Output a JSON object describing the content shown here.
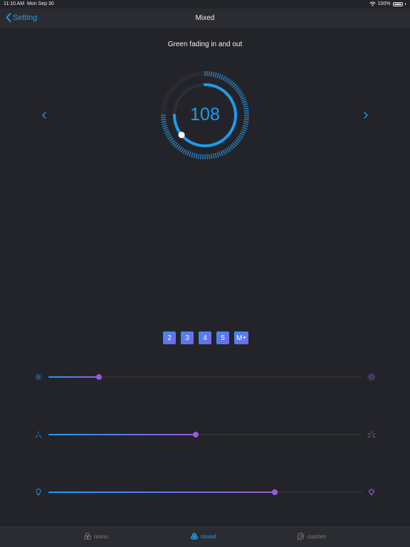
{
  "status": {
    "time": "11:10 AM",
    "date": "Mon Sep 30",
    "battery": "100%"
  },
  "nav": {
    "back_label": "Setting",
    "title": "Mixed"
  },
  "effect": {
    "name": "Green fading in and out",
    "value": "108",
    "dial_fraction": 0.75
  },
  "presets": [
    "2",
    "3",
    "4",
    "5",
    "M+"
  ],
  "sliders": [
    {
      "icon": "brightness-icon",
      "value": 0.16
    },
    {
      "icon": "sparkle-icon",
      "value": 0.47
    },
    {
      "icon": "bulb-icon",
      "value": 0.72
    }
  ],
  "tabs": [
    {
      "label": "mono",
      "icon": "circles-icon",
      "active": false
    },
    {
      "label": "mixed",
      "icon": "rgb-circles-icon",
      "active": true
    },
    {
      "label": "custom",
      "icon": "chat-bubble-icon",
      "active": false
    }
  ],
  "colors": {
    "accent": "#1e9bf0",
    "purple": "#9b59d8",
    "background": "#232429",
    "bar": "#2b2c31"
  }
}
